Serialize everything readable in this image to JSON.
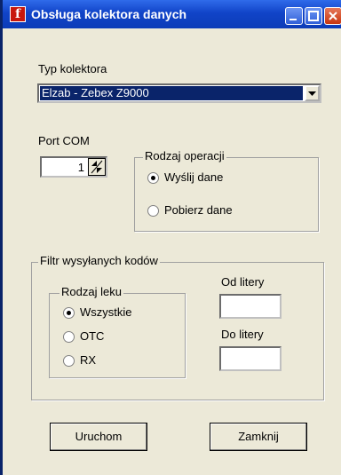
{
  "window": {
    "title": "Obsługa kolektora danych",
    "app_icon": "f"
  },
  "collector_type": {
    "label": "Typ kolektora",
    "selected": "Elzab - Zebex Z9000"
  },
  "port": {
    "label": "Port COM",
    "value": "1"
  },
  "operation": {
    "label": "Rodzaj operacji",
    "options": [
      "Wyślij dane",
      "Pobierz dane"
    ],
    "selected_index": 0
  },
  "filter": {
    "label": "Filtr wysyłanych kodów",
    "drug_type": {
      "label": "Rodzaj leku",
      "options": [
        "Wszystkie",
        "OTC",
        "RX"
      ],
      "selected_index": 0
    },
    "from_letter": {
      "label": "Od litery",
      "value": ""
    },
    "to_letter": {
      "label": "Do litery",
      "value": ""
    }
  },
  "buttons": {
    "run": "Uruchom",
    "close": "Zamknij"
  }
}
